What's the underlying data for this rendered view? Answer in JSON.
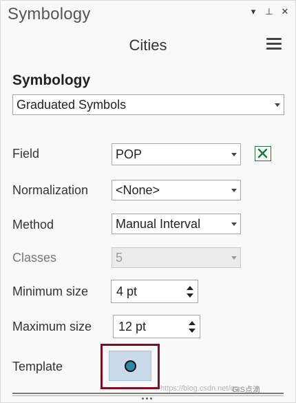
{
  "pane": {
    "title": "Symbology",
    "controls": {
      "dropdown": "▾",
      "pin": "⊥",
      "close": "✕"
    }
  },
  "layer": {
    "name": "Cities"
  },
  "symbology": {
    "heading": "Symbology",
    "primary_symbology": "Graduated Symbols"
  },
  "fields": {
    "field": {
      "label": "Field",
      "value": "POP"
    },
    "normalization": {
      "label": "Normalization",
      "value": "<None>"
    },
    "method": {
      "label": "Method",
      "value": "Manual Interval"
    },
    "classes": {
      "label": "Classes",
      "value": "5"
    },
    "minimum_size": {
      "label": "Minimum size",
      "value": "4 pt"
    },
    "maximum_size": {
      "label": "Maximum size",
      "value": "12 pt"
    },
    "template": {
      "label": "Template"
    }
  },
  "watermark": {
    "url": "https://blog.csdn.net/qq",
    "logo": "GIS点滴"
  },
  "icons": {
    "menu": "hamburger-menu-icon",
    "expression": "excel-expression-icon",
    "template_symbol": "circle-marker-icon"
  },
  "colors": {
    "template_highlight": "#7b1022",
    "template_swatch": "#c9dbe8",
    "marker_fill": "#2a8aa6",
    "excel_green": "#217346"
  }
}
